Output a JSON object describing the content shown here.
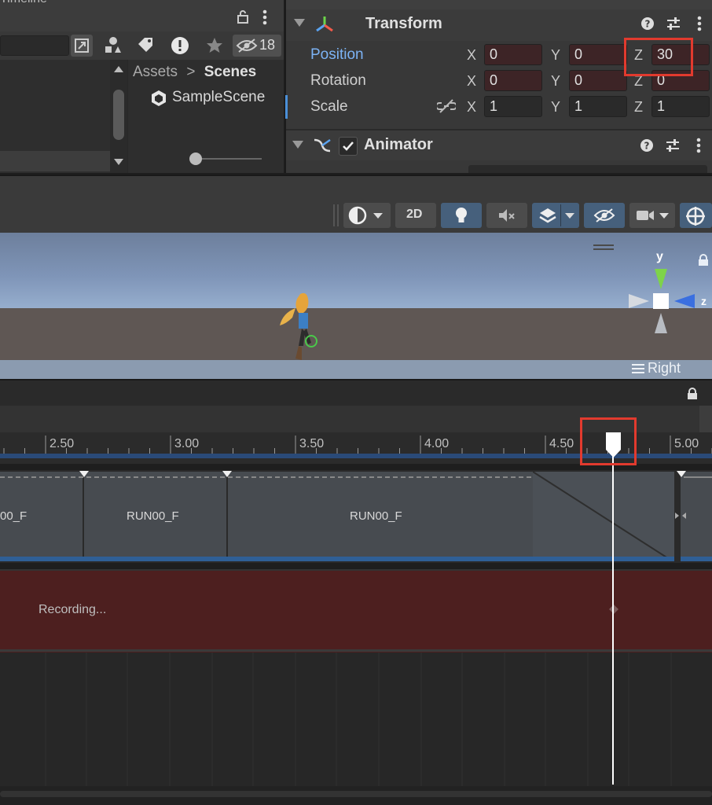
{
  "project": {
    "header_title": "Timeline",
    "hidden_count": "18",
    "breadcrumb_root": "Assets",
    "breadcrumb_separator": ">",
    "breadcrumb_current": "Scenes",
    "scene_item": "SampleScene"
  },
  "inspector": {
    "transform": {
      "title": "Transform",
      "position_label": "Position",
      "rotation_label": "Rotation",
      "scale_label": "Scale",
      "axis_x": "X",
      "axis_y": "Y",
      "axis_z": "Z",
      "position": {
        "x": "0",
        "y": "0",
        "z": "30"
      },
      "rotation": {
        "x": "0",
        "y": "0",
        "z": "0"
      },
      "scale": {
        "x": "1",
        "y": "1",
        "z": "1"
      }
    },
    "animator": {
      "title": "Animator",
      "enabled": true
    }
  },
  "scene_toolbar": {
    "mode_2d": "2D"
  },
  "scene_view": {
    "gizmo_y": "y",
    "gizmo_z": "z",
    "view_label": "Right"
  },
  "timeline": {
    "ruler_labels": [
      "2.50",
      "3.00",
      "3.50",
      "4.00",
      "4.50",
      "5.00"
    ],
    "clips": [
      "00_F",
      "RUN00_F",
      "RUN00_F"
    ],
    "recording_label": "Recording...",
    "playhead_time": 4.75
  },
  "colors": {
    "highlight": "#e23a2e",
    "accent_blue": "#7cb3f5",
    "recording_bg": "#4d1f1f"
  }
}
